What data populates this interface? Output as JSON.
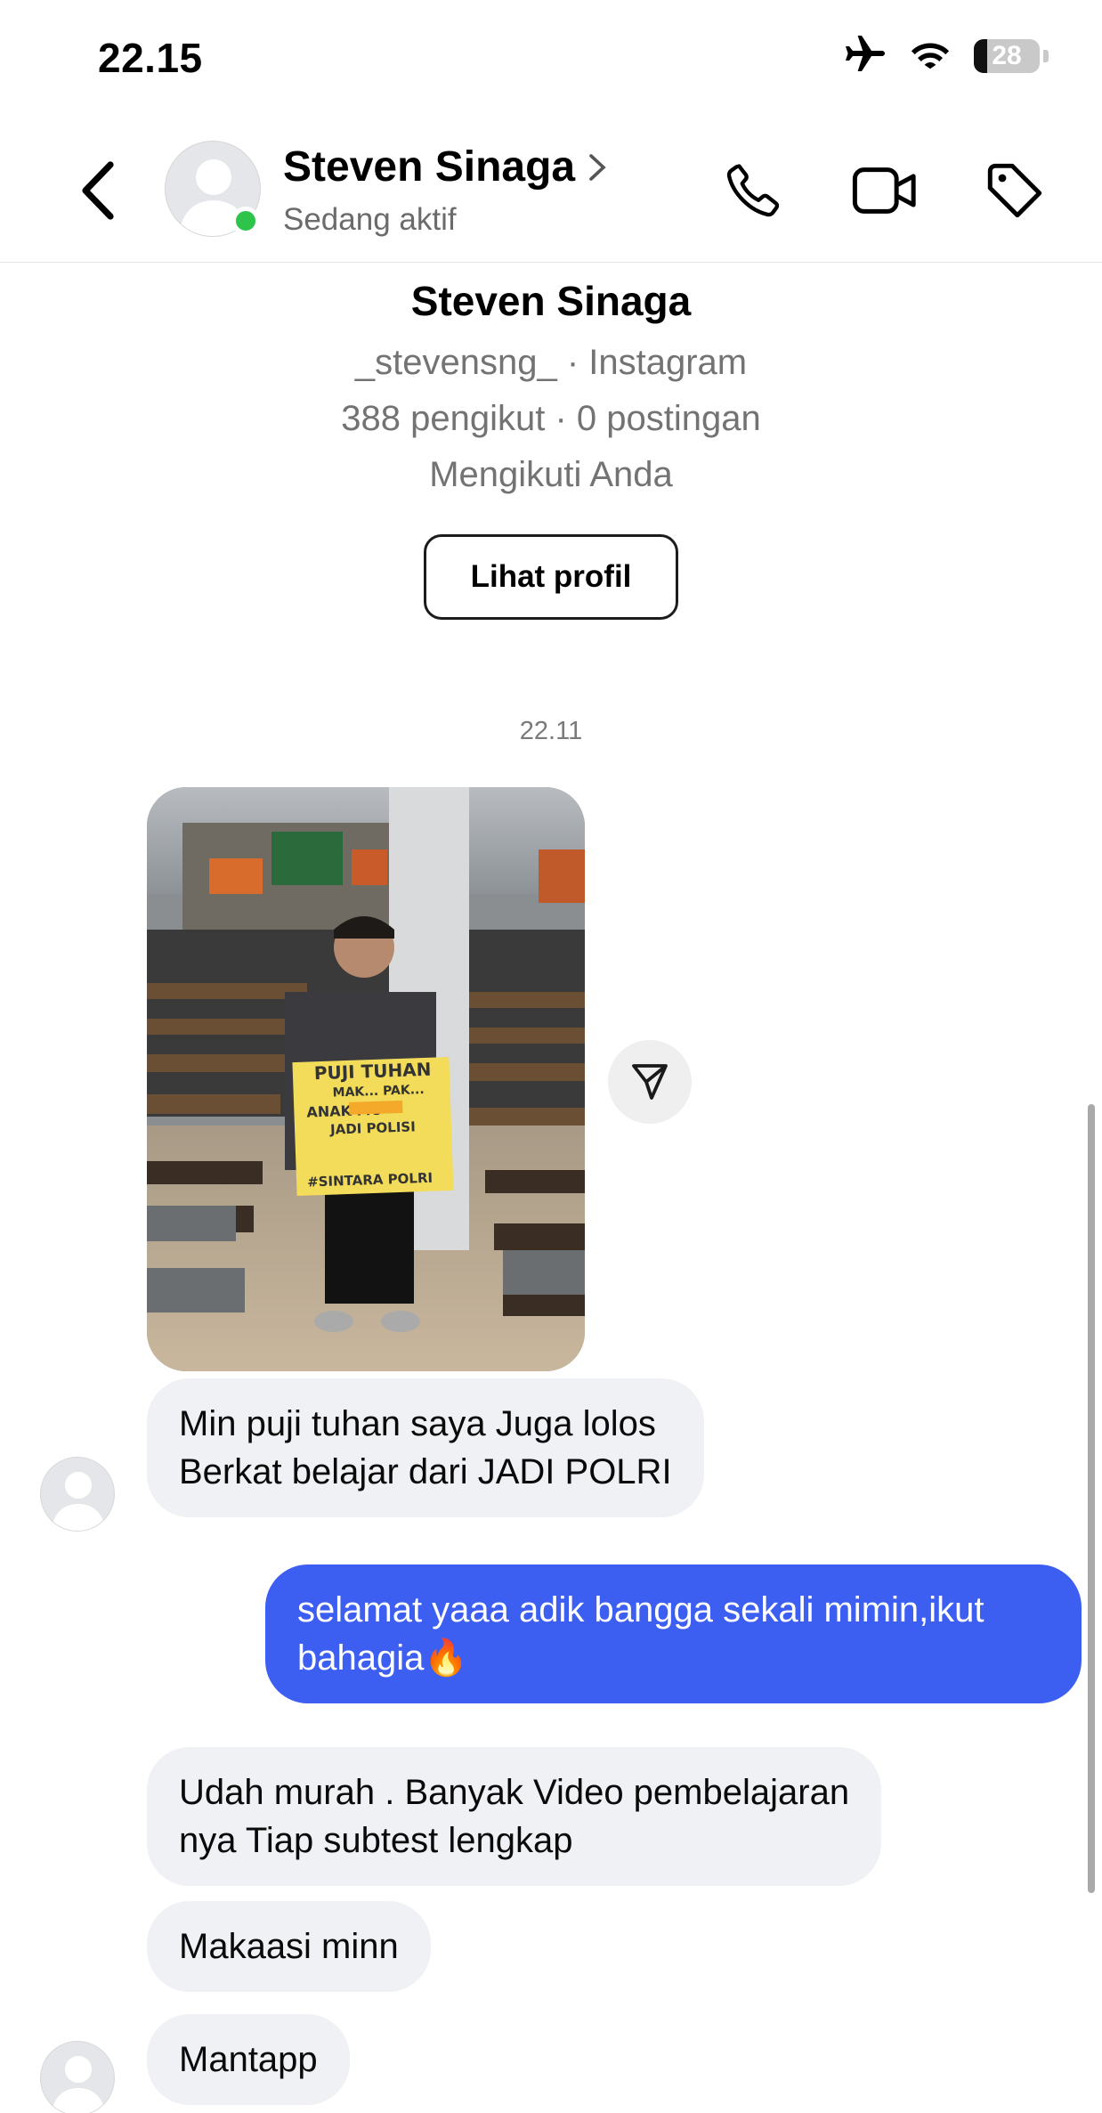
{
  "status_bar": {
    "time": "22.15",
    "battery": "28"
  },
  "header": {
    "name": "Steven Sinaga",
    "status": "Sedang aktif"
  },
  "profile": {
    "name": "Steven Sinaga",
    "username_line": "_stevensng_ · Instagram",
    "stats_line": "388 pengikut · 0 postingan",
    "follow_line": "Mengikuti Anda",
    "view_profile_label": "Lihat profil"
  },
  "timestamp": "22.11",
  "messages": [
    {
      "direction": "in",
      "text": "Min puji tuhan saya Juga lolos\nBerkat belajar dari JADI POLRI"
    },
    {
      "direction": "out",
      "text": "selamat yaaa adik bangga sekali mimin,ikut\nbahagia🔥"
    },
    {
      "direction": "in",
      "text": "Udah murah . Banyak Video pembelajaran\nnya Tiap subtest lengkap"
    },
    {
      "direction": "in",
      "text": "Makaasi minn"
    },
    {
      "direction": "in",
      "text": "Mantapp"
    }
  ],
  "photo_sign": {
    "line1": "PUJI TUHAN",
    "line2": "MAK... PAK...",
    "line3": "ANAK       MU",
    "line4": "JADI POLISI",
    "line5": "#SINTARA POLRI"
  },
  "icons": {
    "airplane": "airplane-icon",
    "wifi": "wifi-icon",
    "back": "chevron-left-icon",
    "call": "phone-icon",
    "video": "video-camera-icon",
    "tag": "tag-icon",
    "share": "paper-plane-icon"
  },
  "colors": {
    "outgoing_bubble": "#3c5ff2",
    "incoming_bubble": "#f0f1f5",
    "active_dot": "#2ec44b"
  }
}
